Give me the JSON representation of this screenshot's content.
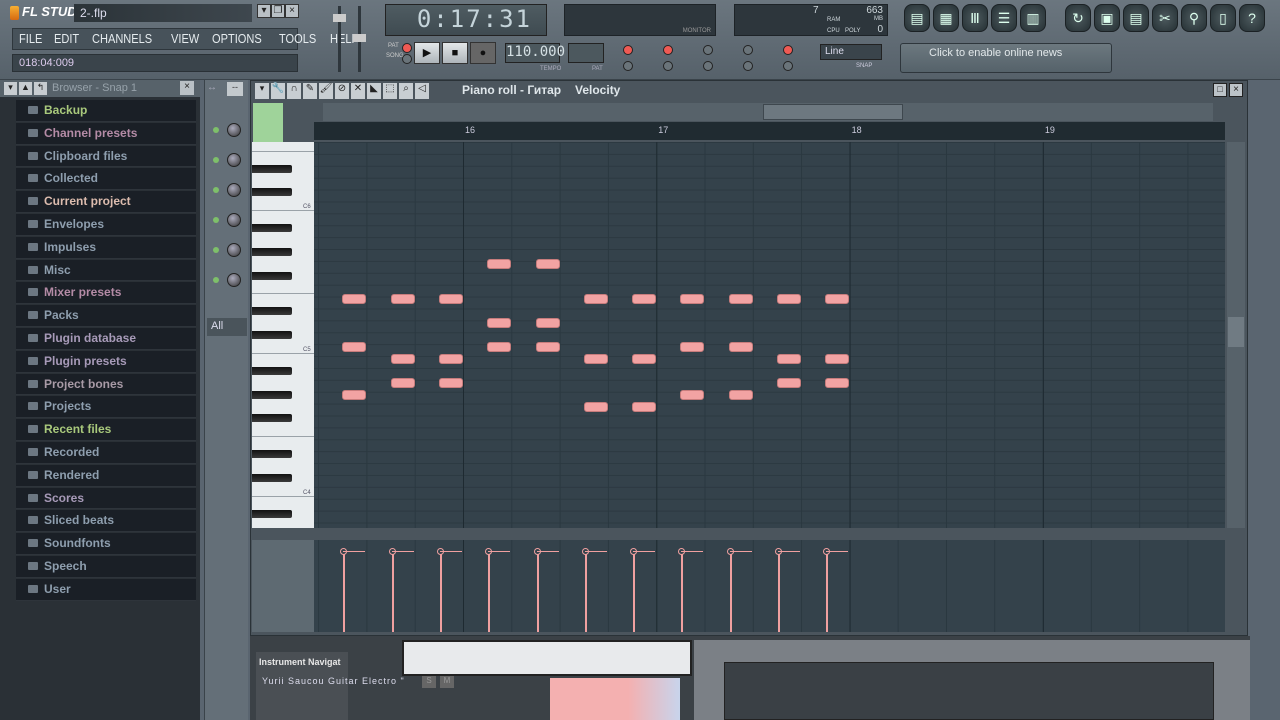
{
  "app": {
    "name": "FL STUDIO",
    "title": "2-.flp",
    "hint": "018:04:009"
  },
  "menu": [
    "FILE",
    "EDIT",
    "CHANNELS",
    "VIEW",
    "OPTIONS",
    "TOOLS",
    "HELP"
  ],
  "transport": {
    "time": "0:17:31",
    "tempo": "110.000",
    "tempo_label": "TEMPO",
    "pat_label": "PAT",
    "pat_song": [
      "PAT",
      "SONG"
    ],
    "mode": "PAT"
  },
  "monitor": {
    "label": "MONITOR",
    "cpu_label": "CPU",
    "poly_label": "POLY",
    "ram_label": "RAM",
    "ram": "663",
    "mb": "MB",
    "cpu": "7",
    "poly": "0"
  },
  "snap": {
    "value": "Line",
    "label": "SNAP"
  },
  "news": {
    "text": "Click to enable online news"
  },
  "toolbar_right": [
    "playlist-icon",
    "step-sequencer-icon",
    "piano-roll-icon",
    "browser-icon",
    "mixer-icon",
    "undo-icon",
    "save-new-icon",
    "save-icon",
    "cut-icon",
    "record-icon",
    "project-info-icon",
    "help-icon"
  ],
  "browser": {
    "title": "Browser - Snap 1",
    "items": [
      {
        "label": "Backup",
        "color": "#a9c97c"
      },
      {
        "label": "Channel presets",
        "color": "#b48ba6"
      },
      {
        "label": "Clipboard files",
        "color": "#8e9eae"
      },
      {
        "label": "Collected",
        "color": "#8e9eae"
      },
      {
        "label": "Current project",
        "color": "#dcbcae"
      },
      {
        "label": "Envelopes",
        "color": "#8e9eae"
      },
      {
        "label": "Impulses",
        "color": "#8e9eae"
      },
      {
        "label": "Misc",
        "color": "#8e9eae"
      },
      {
        "label": "Mixer presets",
        "color": "#b48ba6"
      },
      {
        "label": "Packs",
        "color": "#8e9eae"
      },
      {
        "label": "Plugin database",
        "color": "#a79ab8"
      },
      {
        "label": "Plugin presets",
        "color": "#a79ab8"
      },
      {
        "label": "Project bones",
        "color": "#a89aa6"
      },
      {
        "label": "Projects",
        "color": "#8e9eae"
      },
      {
        "label": "Recent files",
        "color": "#a9c97c"
      },
      {
        "label": "Recorded",
        "color": "#8e9eae"
      },
      {
        "label": "Rendered",
        "color": "#8e9eae"
      },
      {
        "label": "Scores",
        "color": "#a79ab8"
      },
      {
        "label": "Sliced beats",
        "color": "#8e9eae"
      },
      {
        "label": "Soundfonts",
        "color": "#8e9eae"
      },
      {
        "label": "Speech",
        "color": "#8e9eae"
      },
      {
        "label": "User",
        "color": "#8e9eae"
      }
    ]
  },
  "channel_filter": "All",
  "piano_roll": {
    "title": "Piano roll - Гитар",
    "target": "Velocity",
    "bars": [
      "16",
      "17",
      "18",
      "19"
    ],
    "key_labels": [
      "C6",
      "C5",
      "C4"
    ],
    "note_color": "#f2a3a3",
    "notes_unit": "beats from bar 15",
    "notes": [
      {
        "pitch": "E5",
        "start": 1.5
      },
      {
        "pitch": "C5",
        "start": 1.5
      },
      {
        "pitch": "G#4",
        "start": 1.5
      },
      {
        "pitch": "E5",
        "start": 2.5
      },
      {
        "pitch": "B4",
        "start": 2.5
      },
      {
        "pitch": "A4",
        "start": 2.5
      },
      {
        "pitch": "E5",
        "start": 3.5
      },
      {
        "pitch": "B4",
        "start": 3.5
      },
      {
        "pitch": "A4",
        "start": 3.5
      },
      {
        "pitch": "G5",
        "start": 4.5
      },
      {
        "pitch": "D5",
        "start": 4.5
      },
      {
        "pitch": "C5",
        "start": 4.5
      },
      {
        "pitch": "G5",
        "start": 5.5
      },
      {
        "pitch": "D5",
        "start": 5.5
      },
      {
        "pitch": "C5",
        "start": 5.5
      },
      {
        "pitch": "E5",
        "start": 6.5
      },
      {
        "pitch": "B4",
        "start": 6.5
      },
      {
        "pitch": "G4",
        "start": 6.5
      },
      {
        "pitch": "E5",
        "start": 7.5
      },
      {
        "pitch": "B4",
        "start": 7.5
      },
      {
        "pitch": "G4",
        "start": 7.5
      },
      {
        "pitch": "E5",
        "start": 8.5
      },
      {
        "pitch": "C5",
        "start": 8.5
      },
      {
        "pitch": "G#4",
        "start": 8.5
      },
      {
        "pitch": "E5",
        "start": 9.5
      },
      {
        "pitch": "C5",
        "start": 9.5
      },
      {
        "pitch": "G#4",
        "start": 9.5
      },
      {
        "pitch": "E5",
        "start": 10.5
      },
      {
        "pitch": "B4",
        "start": 10.5
      },
      {
        "pitch": "A4",
        "start": 10.5
      },
      {
        "pitch": "E5",
        "start": 11.5
      },
      {
        "pitch": "B4",
        "start": 11.5
      },
      {
        "pitch": "A4",
        "start": 11.5
      }
    ]
  },
  "bottom": {
    "nav_title": "Instrument Navigat",
    "instrument": "Yurii Saucou Guitar Electro \"",
    "s": "S",
    "m": "M"
  }
}
